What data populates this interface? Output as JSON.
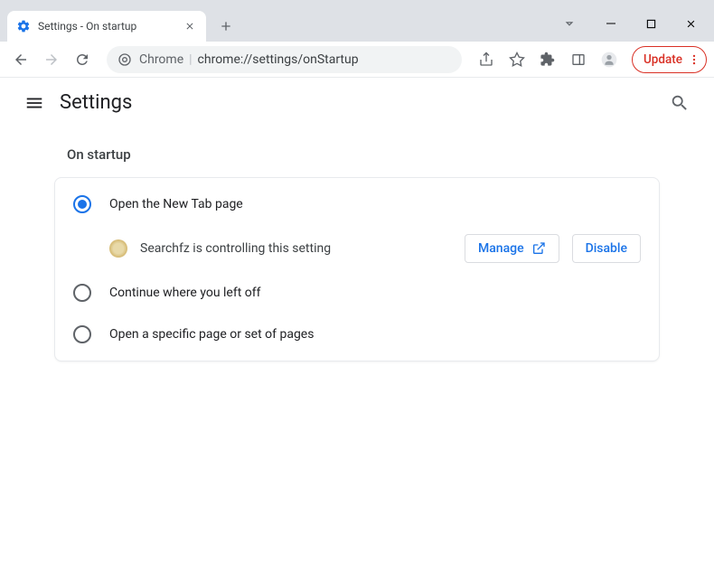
{
  "window": {
    "tab_title": "Settings - On startup"
  },
  "omnibox": {
    "prefix": "Chrome",
    "path": "chrome://settings/onStartup"
  },
  "toolbar": {
    "update_label": "Update"
  },
  "header": {
    "title": "Settings"
  },
  "startup": {
    "section_title": "On startup",
    "options": [
      {
        "label": "Open the New Tab page",
        "selected": true
      },
      {
        "label": "Continue where you left off",
        "selected": false
      },
      {
        "label": "Open a specific page or set of pages",
        "selected": false
      }
    ],
    "extension_notice": {
      "text": "Searchfz is controlling this setting",
      "manage_label": "Manage",
      "disable_label": "Disable"
    }
  }
}
